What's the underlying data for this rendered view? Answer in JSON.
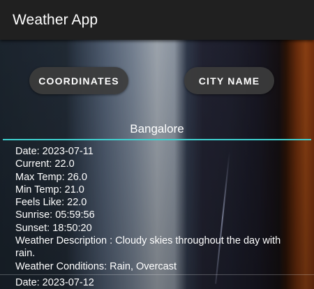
{
  "app": {
    "title": "Weather App"
  },
  "buttons": {
    "coordinates": "COORDINATES",
    "city_name": "CITY NAME"
  },
  "city": {
    "value": "Bangalore"
  },
  "forecast": [
    {
      "date": "Date: 2023-07-11",
      "current": "Current: 22.0",
      "max": "Max Temp: 26.0",
      "min": "Min Temp: 21.0",
      "feels": "Feels Like: 22.0",
      "sunrise": "Sunrise: 05:59:56",
      "sunset": "Sunset: 18:50:20",
      "description": "Weather Description : Cloudy skies throughout the day with rain.",
      "conditions": "Weather Conditions: Rain, Overcast"
    },
    {
      "date": "Date: 2023-07-12"
    }
  ],
  "colors": {
    "accent": "#3fd1d0",
    "app_bar": "#202020",
    "button": "#3c3c3c"
  }
}
